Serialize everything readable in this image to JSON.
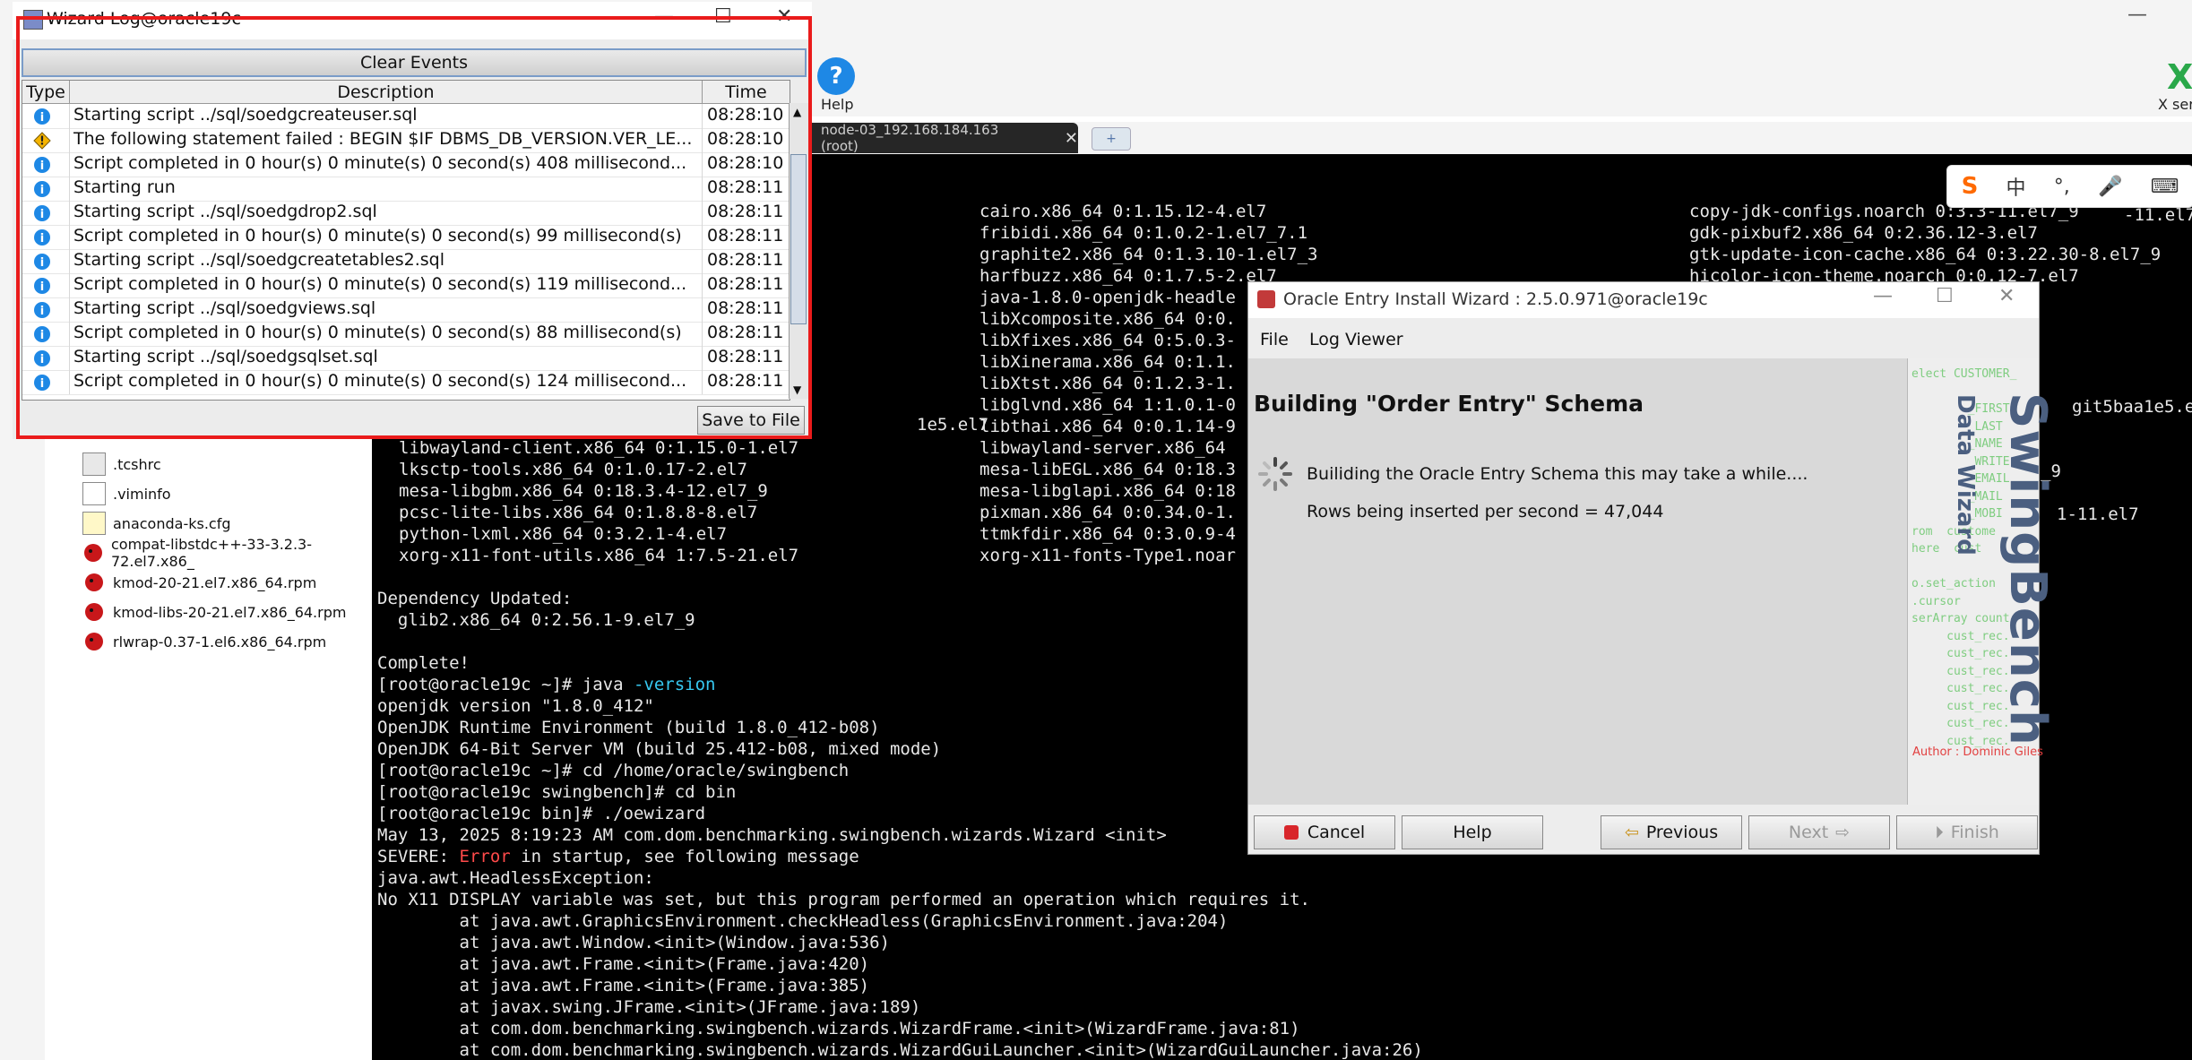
{
  "app": {
    "help_label": "Help",
    "help_glyph": "?",
    "xserver_label": "X server",
    "minimize_glyph": "—"
  },
  "session_tab": {
    "label": "node-03_192.168.184.163 (root)",
    "close_glyph": "✕",
    "add_glyph": "+"
  },
  "files": [
    ".tcshrc",
    ".viminfo",
    "anaconda-ks.cfg",
    "compat-libstdc++-33-3.2.3-72.el7.x86_",
    "kmod-20-21.el7.x86_64.rpm",
    "kmod-libs-20-21.el7.x86_64.rpm",
    "rlwrap-0.37-1.el6.x86_64.rpm"
  ],
  "terminal": {
    "col2_top": [
      "cairo.x86_64 0:1.15.12-4.el7",
      "fribidi.x86_64 0:1.0.2-1.el7_7.1",
      "graphite2.x86_64 0:1.3.10-1.el7_3",
      "harfbuzz.x86_64 0:1.7.5-2.el7",
      "java-1.8.0-openjdk-headle",
      "libXcomposite.x86_64 0:0.",
      "libXfixes.x86_64 0:5.0.3-",
      "libXinerama.x86_64 0:1.1.",
      "libXtst.x86_64 0:1.2.3-1.",
      "libglvnd.x86_64 1:1.0.1-0",
      "libthai.x86_64 0:0.1.14-9",
      "libwayland-server.x86_64",
      "mesa-libEGL.x86_64 0:18.3",
      "mesa-libglapi.x86_64 0:18",
      "pixman.x86_64 0:0.34.0-1.",
      "ttmkfdir.x86_64 0:3.0.9-4",
      "xorg-x11-fonts-Type1.noar"
    ],
    "col3_top": [
      "copy-jdk-configs.noarch 0:3.3-11.el7_9",
      "gdk-pixbuf2.x86_64 0:2.36.12-3.el7",
      "gtk-update-icon-cache.x86_64 0:3.22.30-8.el7_9",
      "hicolor-icon-theme.noarch 0:0.12-7.el7"
    ],
    "col3_fragments": [
      "-11.el7",
      "git5baa1e5.el7",
      "_9",
      "1-11.el7"
    ],
    "col1_fragments": [
      "1e5.el7"
    ],
    "col1": [
      "libwayland-client.x86_64 0:1.15.0-1.el7",
      "lksctp-tools.x86_64 0:1.0.17-2.el7",
      "mesa-libgbm.x86_64 0:18.3.4-12.el7_9",
      "pcsc-lite-libs.x86_64 0:1.8.8-8.el7",
      "python-lxml.x86_64 0:3.2.1-4.el7",
      "xorg-x11-font-utils.x86_64 1:7.5-21.el7"
    ],
    "dep_updated": "Dependency Updated:",
    "glib": "  glib2.x86_64 0:2.56.1-9.el7_9",
    "complete": "Complete!",
    "prompt1": "[root@oracle19c ~]# java ",
    "prompt1_arg": "-version",
    "out1": "openjdk version \"1.8.0_412\"",
    "out2": "OpenJDK Runtime Environment (build 1.8.0_412-b08)",
    "out3": "OpenJDK 64-Bit Server VM (build 25.412-b08, mixed mode)",
    "prompt2": "[root@oracle19c ~]# cd /home/oracle/swingbench",
    "prompt3": "[root@oracle19c swingbench]# cd bin",
    "prompt4": "[root@oracle19c bin]# ./oewizard",
    "out4": "May 13, 2025 8:19:23 AM com.dom.benchmarking.swingbench.wizards.Wizard <init>",
    "severe_pre": "SEVERE: ",
    "severe_err": "Error",
    "severe_post": " in startup, see following message",
    "out5": "java.awt.HeadlessException:",
    "out6": "No X11 DISPLAY variable was set, but this program performed an operation which requires it.",
    "trace": [
      "        at java.awt.GraphicsEnvironment.checkHeadless(GraphicsEnvironment.java:204)",
      "        at java.awt.Window.<init>(Window.java:536)",
      "        at java.awt.Frame.<init>(Frame.java:420)",
      "        at java.awt.Frame.<init>(Frame.java:385)",
      "        at javax.swing.JFrame.<init>(JFrame.java:189)",
      "        at com.dom.benchmarking.swingbench.wizards.WizardFrame.<init>(WizardFrame.java:81)",
      "        at com.dom.benchmarking.swingbench.wizards.WizardGuiLauncher.<init>(WizardGuiLauncher.java:26)"
    ]
  },
  "ime": {
    "logo": "S",
    "zh": "中",
    "punct": "°,",
    "mic": "🎤",
    "kbd": "⌨"
  },
  "wizard_log": {
    "title": "Wizard Log@oracle19c",
    "clear_label": "Clear Events",
    "col_type": "Type",
    "col_desc": "Description",
    "col_time": "Time",
    "save_label": "Save to File",
    "rows": [
      {
        "type": "info",
        "desc": "Starting script ../sql/soedgcreateuser.sql",
        "time": "08:28:10"
      },
      {
        "type": "warn",
        "desc": "The following statement failed : BEGIN   $IF DBMS_DB_VERSION.VER_LE...",
        "time": "08:28:10"
      },
      {
        "type": "info",
        "desc": "Script completed in 0 hour(s) 0 minute(s) 0 second(s) 408 millisecond...",
        "time": "08:28:10"
      },
      {
        "type": "info",
        "desc": "Starting run",
        "time": "08:28:11"
      },
      {
        "type": "info",
        "desc": "Starting script ../sql/soedgdrop2.sql",
        "time": "08:28:11"
      },
      {
        "type": "info",
        "desc": "Script completed in 0 hour(s) 0 minute(s) 0 second(s) 99 millisecond(s)",
        "time": "08:28:11"
      },
      {
        "type": "info",
        "desc": "Starting script ../sql/soedgcreatetables2.sql",
        "time": "08:28:11"
      },
      {
        "type": "info",
        "desc": "Script completed in 0 hour(s) 0 minute(s) 0 second(s) 119 millisecond...",
        "time": "08:28:11"
      },
      {
        "type": "info",
        "desc": "Starting script ../sql/soedgviews.sql",
        "time": "08:28:11"
      },
      {
        "type": "info",
        "desc": "Script completed in 0 hour(s) 0 minute(s) 0 second(s) 88 millisecond(s)",
        "time": "08:28:11"
      },
      {
        "type": "info",
        "desc": "Starting script ../sql/soedgsqlset.sql",
        "time": "08:28:11"
      },
      {
        "type": "info",
        "desc": "Script completed in 0 hour(s) 0 minute(s) 0 second(s) 124 millisecond...",
        "time": "08:28:11"
      }
    ]
  },
  "entry_wizard": {
    "title": "Oracle Entry Install Wizard : 2.5.0.971@oracle19c",
    "menu_file": "File",
    "menu_log": "Log Viewer",
    "heading": "Building \"Order Entry\" Schema",
    "message": "Builiding the Oracle Entry Schema this may take a while....",
    "rows_text": "Rows being inserted per second = 47,044",
    "brand_main": "SwingBench",
    "brand_sub": "Data Wizard",
    "author": "Author : Dominic Giles",
    "code_lines": [
      "elect CUSTOMER_",
      "                 ",
      "        _FIRST",
      "        _LAST",
      "        _NAME",
      "        _WRITE",
      "        _EMAIL",
      "        _MAIL",
      "        _MOBI",
      "rom  custome",
      "here  cust",
      "",
      "o.set_action",
      ".cursor",
      "serArray count",
      "     cust_rec.",
      "     cust_rec.",
      "     cust_rec.",
      "     cust_rec.",
      "     cust_rec.",
      "     cust_rec.",
      "     cust_rec."
    ],
    "btn_cancel": "Cancel",
    "btn_help": "Help",
    "btn_previous": "Previous",
    "btn_next": "Next",
    "btn_finish": "Finish"
  },
  "colors": {
    "highlight_border": "#ea1b1b",
    "terminal_bg": "#000000",
    "info_icon": "#1e88e5",
    "warn_icon": "#f5b400"
  }
}
